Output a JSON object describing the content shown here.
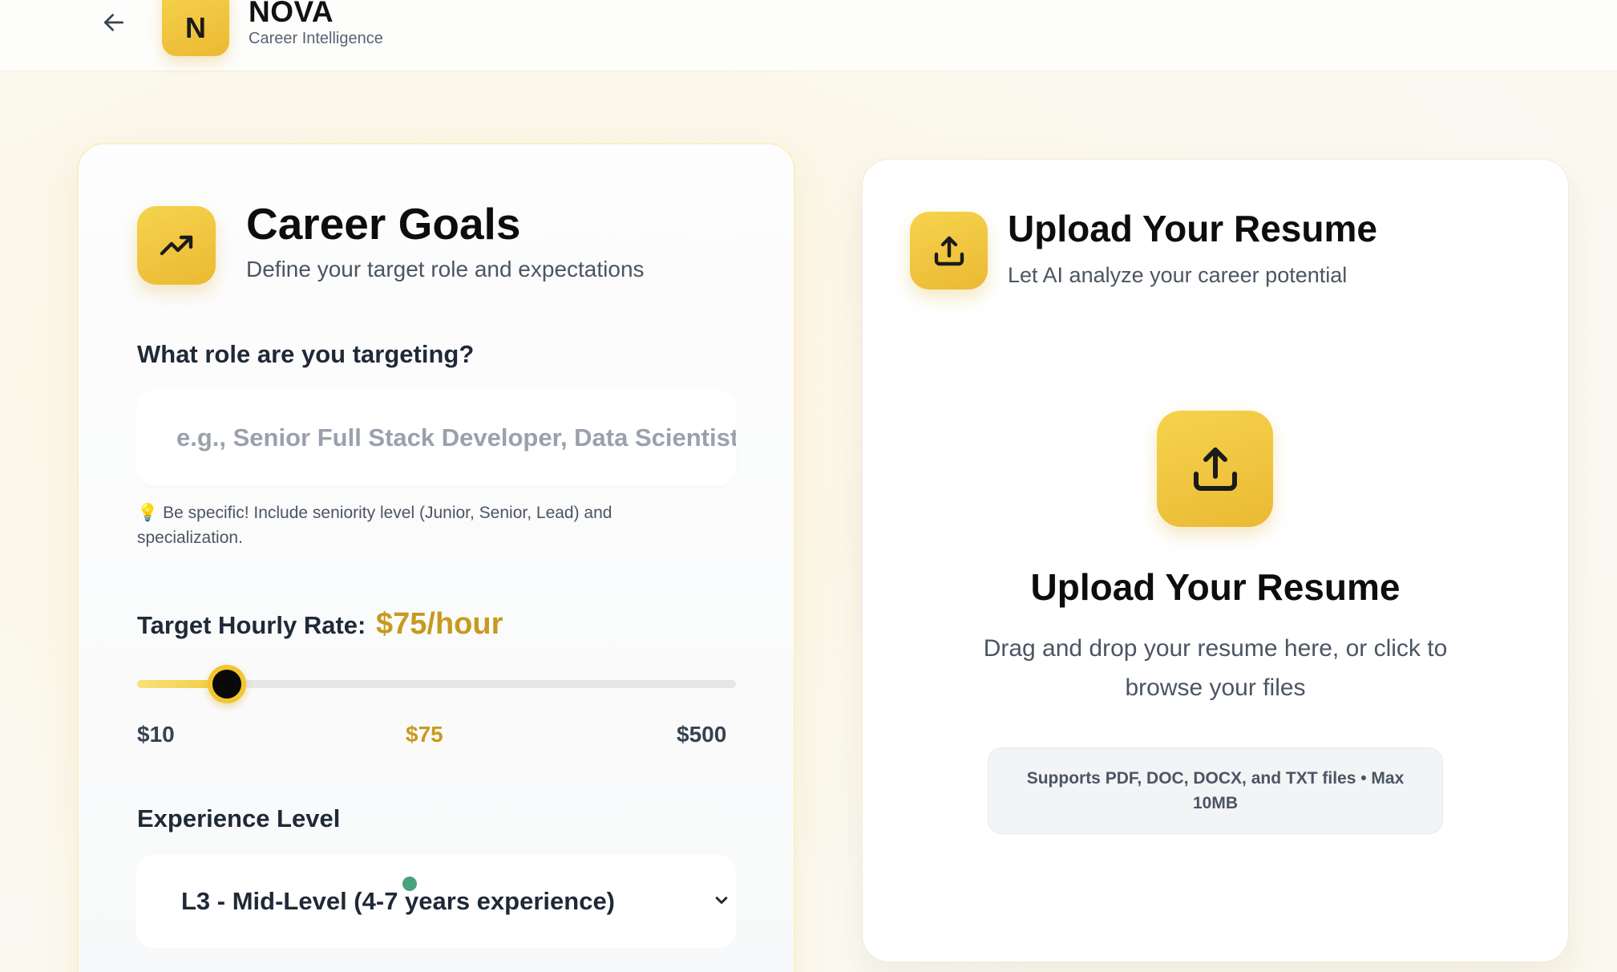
{
  "header": {
    "logo_letter": "N",
    "brand_name": "NOVA",
    "brand_subtitle": "Career Intelligence"
  },
  "goals": {
    "title": "Career Goals",
    "subtitle": "Define your target role and expectations",
    "role_label": "What role are you targeting?",
    "role_value": "",
    "role_placeholder": "e.g., Senior Full Stack Developer, Data Scientist",
    "hint_icon": "💡",
    "hint_text": "Be specific! Include seniority level (Junior, Senior, Lead) and specialization.",
    "rate_label": "Target Hourly Rate:",
    "rate_value_text": "$75/hour",
    "rate": {
      "min": 10,
      "max": 500,
      "value": 75
    },
    "rate_min_label": "$10",
    "rate_mid_label": "$75",
    "rate_max_label": "$500",
    "experience_label": "Experience Level",
    "experience_selected": "L3 - Mid-Level (4-7 years experience)"
  },
  "upload": {
    "title": "Upload Your Resume",
    "subtitle": "Let AI analyze your career potential",
    "drop_title": "Upload Your Resume",
    "drop_desc": "Drag and drop your resume here, or click to browse your files",
    "supports": "Supports PDF, DOC, DOCX, and TXT files • Max 10MB"
  },
  "icons": {
    "back": "arrow-left-icon",
    "goals": "trending-up-icon",
    "upload": "upload-icon",
    "select": "chevron-down-icon",
    "hint": "lightbulb-icon"
  },
  "colors": {
    "accent": "#f3c62f",
    "accent_text": "#c79a1e",
    "background": "#fbf7ea"
  }
}
